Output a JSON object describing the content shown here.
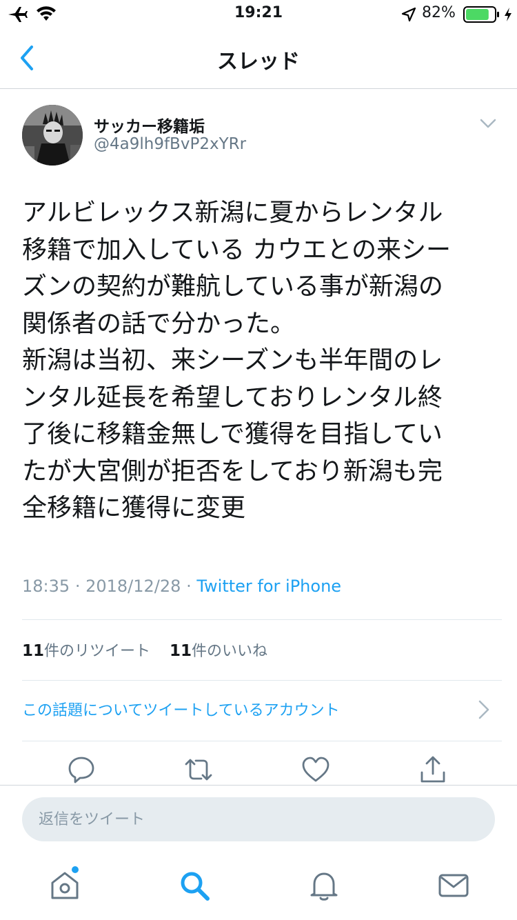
{
  "status_bar": {
    "time": "19:21",
    "battery_percent": "82%",
    "battery_level": 0.82,
    "icons": [
      "airplane-icon",
      "wifi-icon",
      "location-icon",
      "battery-icon",
      "charging-icon"
    ]
  },
  "nav": {
    "title": "スレッド",
    "back_icon": "chevron-left-icon"
  },
  "tweet": {
    "display_name": "サッカー移籍垢",
    "username": "@4a9lh9fBvP2xYRr",
    "text": "アルビレックス新潟に夏からレンタル\n移籍で加入している カウエとの来シー\nズンの契約が難航している事が新潟の\n関係者の話で分かった。\n新潟は当初、来シーズンも半年間のレ\nンタル延長を希望しておりレンタル終\n了後に移籍金無しで獲得を目指してい\nたが大宮側が拒否をしており新潟も完\n全移籍に獲得に変更",
    "time": "18:35",
    "date": "2018/12/28",
    "separator": "·",
    "source": "Twitter for iPhone"
  },
  "stats": {
    "retweet_count": "11",
    "retweet_label": "件のリツイート",
    "like_count": "11",
    "like_label": "件のいいね"
  },
  "engagement_link": "この話題についてツイートしているアカウント",
  "actions": [
    "reply-icon",
    "retweet-icon",
    "like-icon",
    "share-icon"
  ],
  "reply": {
    "placeholder": "返信をツイート"
  },
  "tabs": [
    "home-icon",
    "search-icon",
    "notifications-icon",
    "messages-icon"
  ],
  "colors": {
    "accent": "#1da1f2",
    "battery": "#4cd964",
    "secondary_text": "#657786",
    "divider": "#e1e8ed"
  }
}
